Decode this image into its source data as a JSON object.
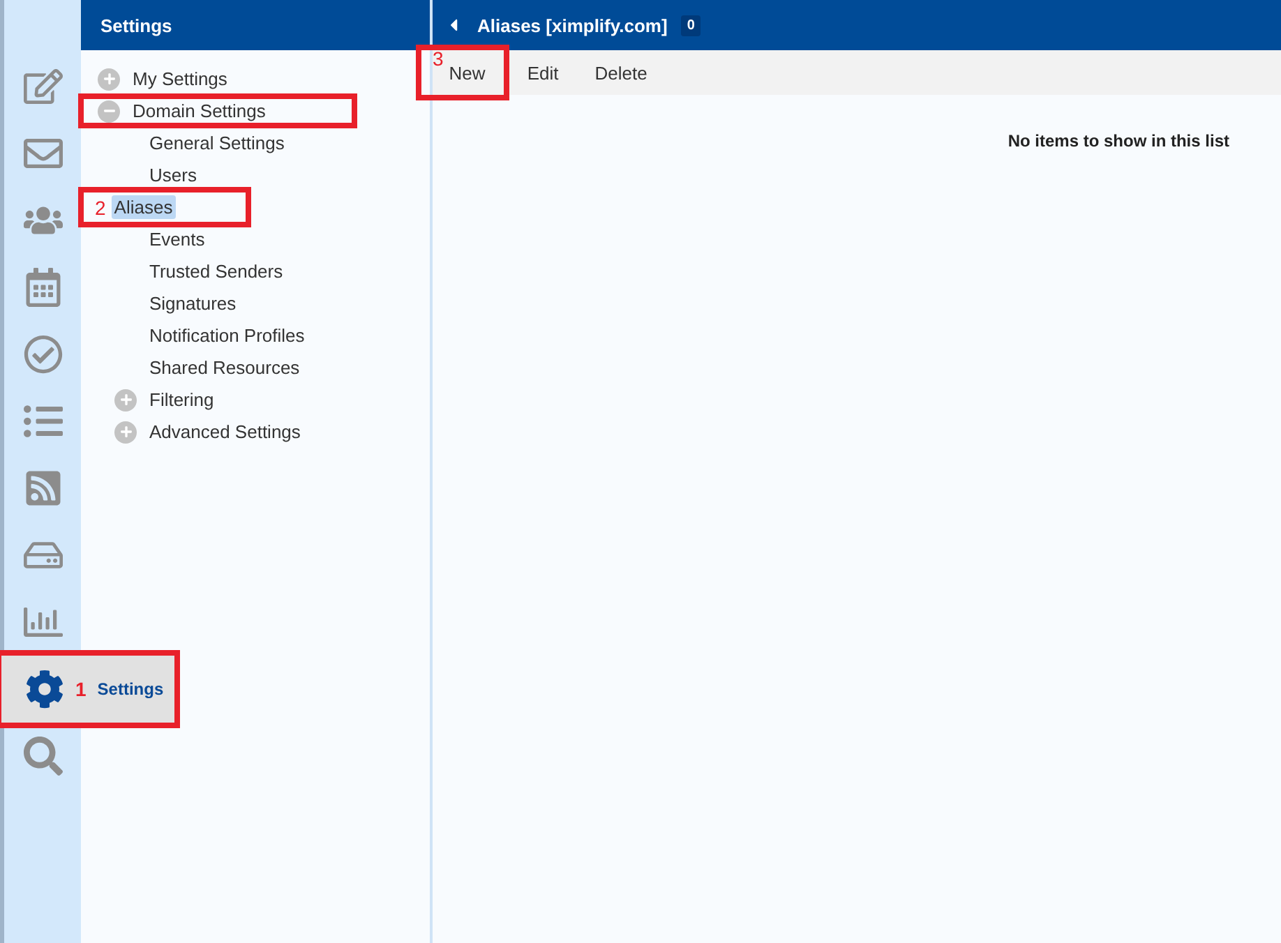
{
  "nav_rail": {
    "items": [
      {
        "kind": "compose",
        "selected": false,
        "highlighted": false
      },
      {
        "kind": "mail",
        "selected": false,
        "highlighted": false
      },
      {
        "kind": "contacts",
        "selected": false,
        "highlighted": false
      },
      {
        "kind": "calendar",
        "selected": false,
        "highlighted": false
      },
      {
        "kind": "tasks",
        "selected": false,
        "highlighted": false
      },
      {
        "kind": "notes",
        "selected": false,
        "highlighted": false
      },
      {
        "kind": "feeds",
        "selected": false,
        "highlighted": false
      },
      {
        "kind": "storage",
        "selected": false,
        "highlighted": false
      },
      {
        "kind": "reports",
        "selected": false,
        "highlighted": false
      },
      {
        "kind": "settings",
        "selected": true,
        "highlighted": true,
        "callout": "1",
        "label": "Settings"
      },
      {
        "kind": "search",
        "selected": false,
        "highlighted": false
      }
    ]
  },
  "tree_panel": {
    "title": "Settings",
    "items": [
      {
        "label": "My Settings",
        "expanded": false,
        "selected": false,
        "highlighted": false
      },
      {
        "label": "Domain Settings",
        "expanded": true,
        "selected": false,
        "highlighted": true,
        "children": [
          {
            "label": "General Settings",
            "selected": false,
            "highlighted": false
          },
          {
            "label": "Users",
            "selected": false,
            "highlighted": false
          },
          {
            "label": "Aliases",
            "selected": true,
            "highlighted": true,
            "callout": "2"
          },
          {
            "label": "Events",
            "selected": false,
            "highlighted": false
          },
          {
            "label": "Trusted Senders",
            "selected": false,
            "highlighted": false
          },
          {
            "label": "Signatures",
            "selected": false,
            "highlighted": false
          },
          {
            "label": "Notification Profiles",
            "selected": false,
            "highlighted": false
          },
          {
            "label": "Shared Resources",
            "selected": false,
            "highlighted": false
          },
          {
            "label": "Filtering",
            "expanded": false,
            "selected": false,
            "highlighted": false
          },
          {
            "label": "Advanced Settings",
            "expanded": false,
            "selected": false,
            "highlighted": false
          }
        ]
      }
    ]
  },
  "main": {
    "title": "Aliases [ximplify.com]",
    "count": "0",
    "toolbar": [
      {
        "label": "New",
        "highlighted": true,
        "callout": "3"
      },
      {
        "label": "Edit",
        "highlighted": false
      },
      {
        "label": "Delete",
        "highlighted": false
      }
    ],
    "empty_message": "No items to show in this list"
  }
}
